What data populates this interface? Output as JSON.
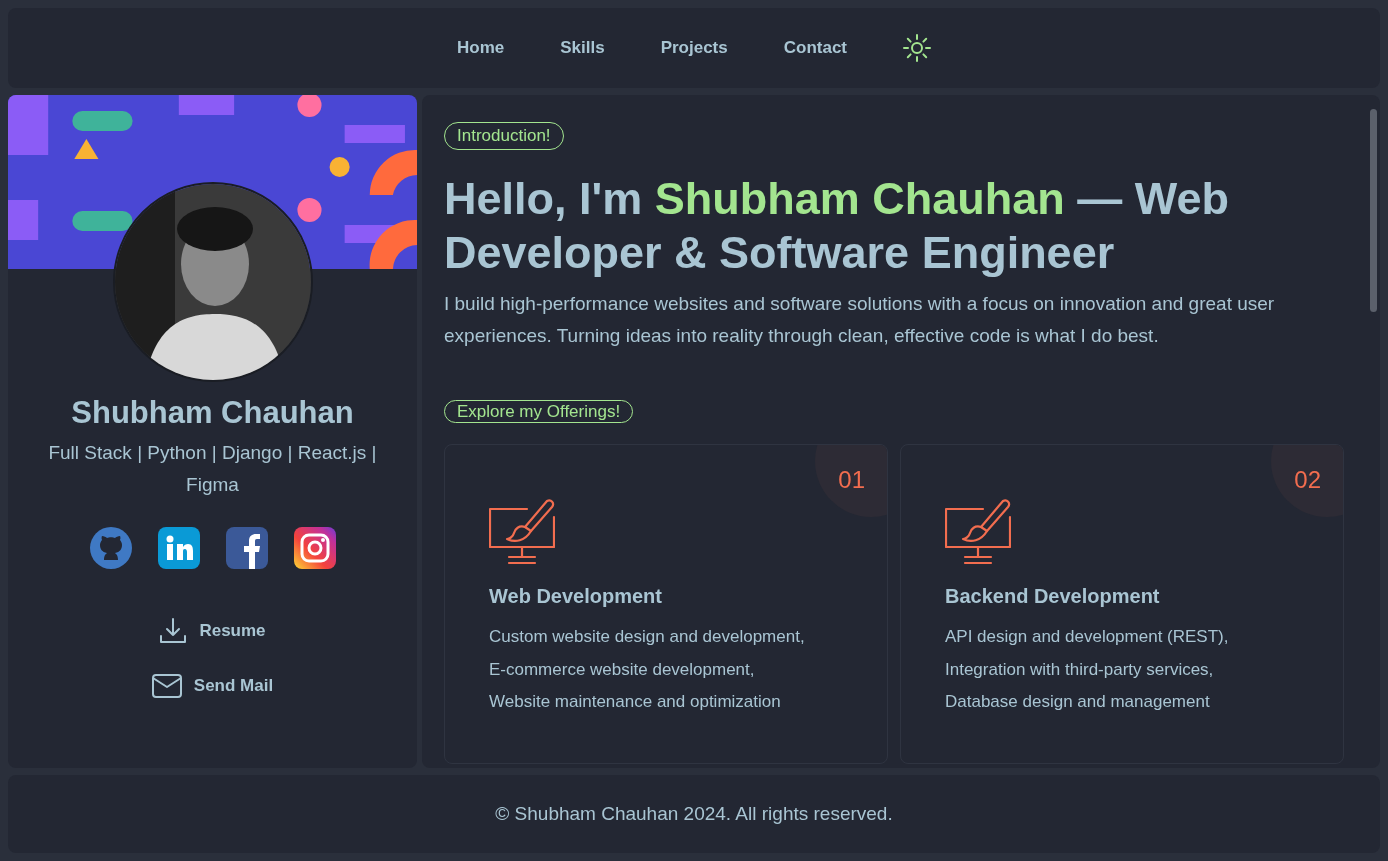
{
  "nav": {
    "links": [
      {
        "label": "Home"
      },
      {
        "label": "Skills"
      },
      {
        "label": "Projects"
      },
      {
        "label": "Contact"
      }
    ]
  },
  "profile": {
    "name": "Shubham Chauhan",
    "subtitle": "Full Stack | Python | Django | React.js | Figma",
    "socials": [
      {
        "kind": "github"
      },
      {
        "kind": "linkedin"
      },
      {
        "kind": "facebook"
      },
      {
        "kind": "instagram"
      }
    ],
    "actions": [
      {
        "kind": "download",
        "label": "Resume"
      },
      {
        "kind": "mail",
        "label": "Send Mail"
      }
    ]
  },
  "intro": {
    "badge": "Introduction!",
    "heading": {
      "before": "Hello, I'm ",
      "name": "Shubham Chauhan",
      "after": " — Web Developer & Software Engineer"
    },
    "text": "I build high-performance websites and software solutions with a focus on innovation and great user experiences. Turning ideas into reality through clean, effective code is what I do best."
  },
  "offerings": {
    "badge": "Explore my Offerings!",
    "cards": [
      {
        "number": "01",
        "title": "Web Development",
        "lines": [
          "Custom website design and development,",
          "E-commerce website development,",
          "Website maintenance and optimization"
        ]
      },
      {
        "number": "02",
        "title": "Backend Development",
        "lines": [
          "API design and development (REST),",
          "Integration with third-party services,",
          "Database design and management"
        ]
      }
    ]
  },
  "footer": "© Shubham Chauhan 2024. All rights reserved."
}
